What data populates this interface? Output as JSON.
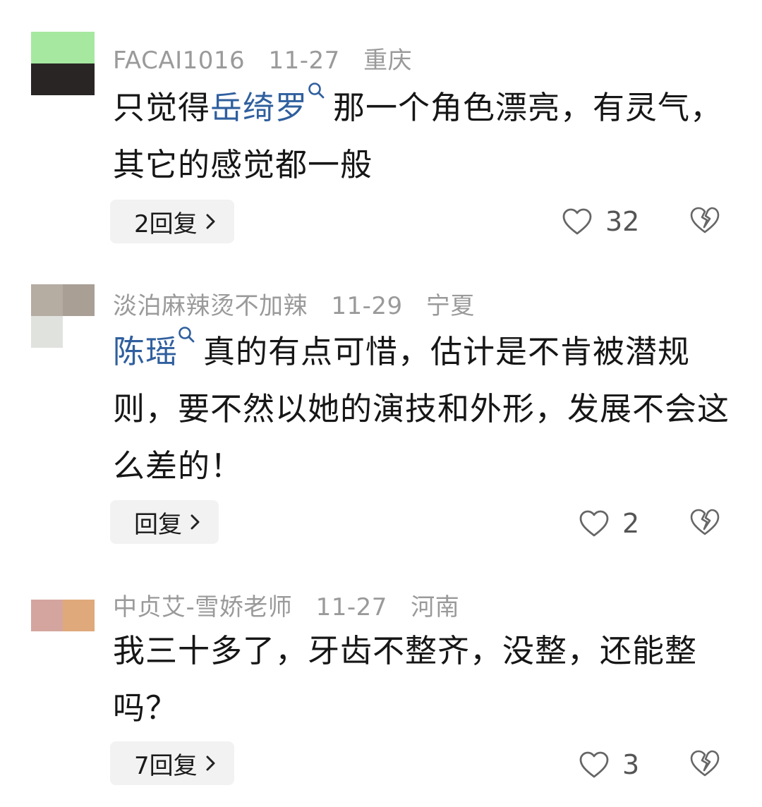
{
  "comments": [
    {
      "username": "FACAI1016",
      "date": "11-27",
      "location": "重庆",
      "text_prefix": "只觉得",
      "mention": "岳绮罗",
      "text_suffix": "那一个角色漂亮，有灵气，其它的感觉都一般",
      "reply_label": "2回复",
      "likes": "32",
      "avatar_colors": [
        "#a6e8a0",
        "#2a2525"
      ]
    },
    {
      "username": "淡泊麻辣烫不加辣",
      "date": "11-29",
      "location": "宁夏",
      "text_prefix": "",
      "mention": "陈瑶",
      "text_suffix": "真的有点可惜，估计是不肯被潜规则，要不然以她的演技和外形，发展不会这么差的！",
      "reply_label": "回复",
      "likes": "2",
      "avatar_colors": [
        "#b5aca2",
        "#a99f95",
        "#e0e2de"
      ]
    },
    {
      "username": "中贞艾-雪娇老师",
      "date": "11-27",
      "location": "河南",
      "text_prefix": "",
      "mention": "",
      "text_suffix": "我三十多了，牙齿不整齐，没整，还能整吗？",
      "reply_label": "7回复",
      "likes": "3",
      "avatar_colors": [
        "#d4a59f",
        "#dfa97b"
      ]
    }
  ],
  "colors": {
    "mention": "#2f5f9e",
    "meta": "#9a9a9a",
    "reply_bg": "#f2f2f2"
  },
  "icons": [
    "search-icon",
    "chevron-right-icon",
    "heart-outline-icon",
    "broken-heart-icon"
  ]
}
